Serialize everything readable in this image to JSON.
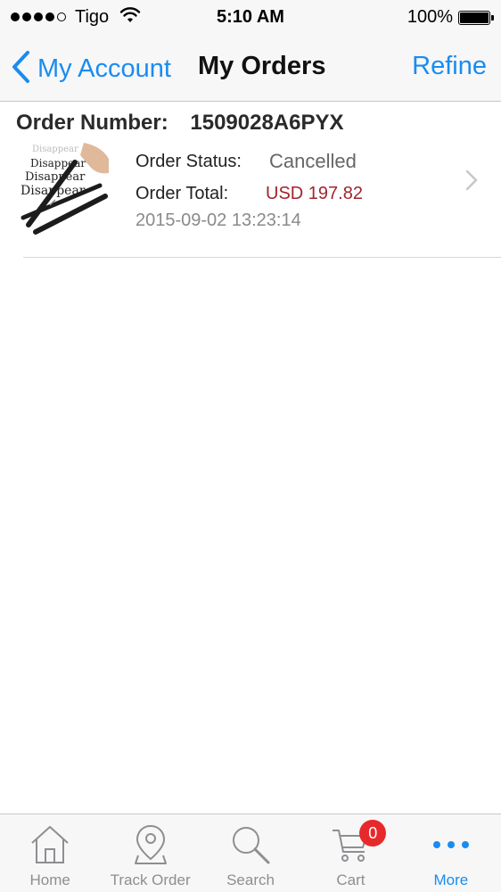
{
  "status_bar": {
    "carrier": "Tigo",
    "time": "5:10 AM",
    "battery": "100%"
  },
  "nav": {
    "back_label": "My Account",
    "title": "My Orders",
    "refine_label": "Refine"
  },
  "order": {
    "number_label": "Order Number:",
    "number": "1509028A6PYX",
    "thumbnail_text": [
      "Disappear",
      "Disappear",
      "Disappear",
      "Disappear"
    ],
    "status_label": "Order Status:",
    "status": "Cancelled",
    "total_label": "Order Total:",
    "total": "USD 197.82",
    "date": "2015-09-02 13:23:14"
  },
  "tab_bar": {
    "items": [
      {
        "label": "Home",
        "icon": "home-icon"
      },
      {
        "label": "Track Order",
        "icon": "location-pin-icon"
      },
      {
        "label": "Search",
        "icon": "search-icon"
      },
      {
        "label": "Cart",
        "icon": "cart-icon"
      },
      {
        "label": "More",
        "icon": "more-icon"
      }
    ],
    "active_index": 4,
    "cart_badge": "0"
  },
  "colors": {
    "accent": "#1a8cf0",
    "price": "#a3242c",
    "badge": "#e8292c"
  }
}
